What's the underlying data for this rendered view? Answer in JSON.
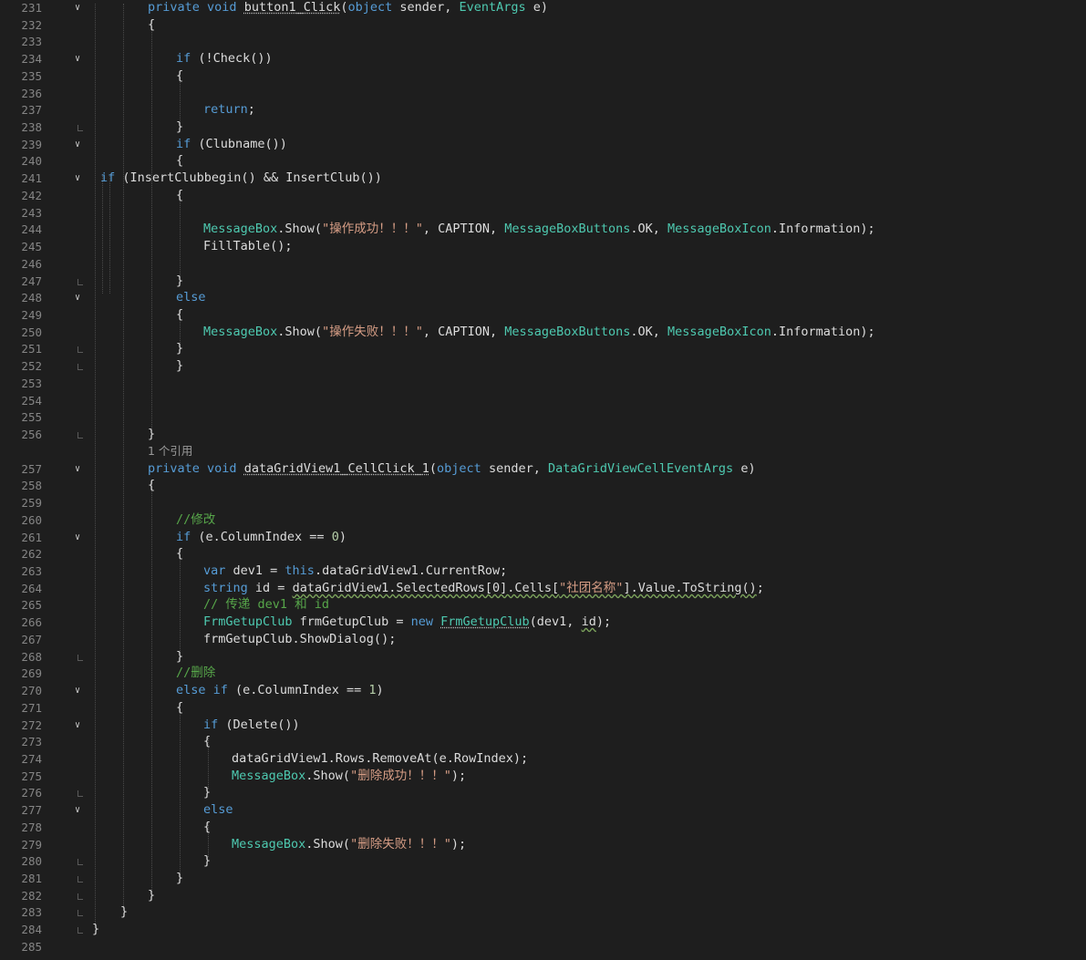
{
  "colors": {
    "background": "#1e1e1e",
    "line_number": "#858585",
    "keyword": "#569cd6",
    "type": "#4ec9b0",
    "string": "#d69d85",
    "comment": "#57a64a",
    "identifier": "#dcdcdc",
    "number": "#b5cea8"
  },
  "icons": {
    "fold_open": "chevron-down-icon",
    "fold_close": "fold-end-bracket"
  },
  "codelens": "1 个引用",
  "lines": [
    {
      "num": "231",
      "fold": "open",
      "indent": 2,
      "tokens": [
        [
          "kw",
          "private"
        ],
        [
          "pl",
          " "
        ],
        [
          "kw",
          "void"
        ],
        [
          "pl",
          " "
        ],
        [
          "pl",
          "button1_Click",
          "dots"
        ],
        [
          "pl",
          "("
        ],
        [
          "kw",
          "object"
        ],
        [
          "pl",
          " sender, "
        ],
        [
          "ty",
          "EventArgs"
        ],
        [
          "pl",
          " e)"
        ]
      ]
    },
    {
      "num": "232",
      "indent": 2,
      "tokens": [
        [
          "pl",
          "{"
        ]
      ]
    },
    {
      "num": "233",
      "tokens": []
    },
    {
      "num": "234",
      "fold": "open",
      "indent": 3,
      "tokens": [
        [
          "kw",
          "if"
        ],
        [
          "pl",
          " (!Check())"
        ]
      ]
    },
    {
      "num": "235",
      "indent": 3,
      "tokens": [
        [
          "pl",
          "{"
        ]
      ]
    },
    {
      "num": "236",
      "tokens": []
    },
    {
      "num": "237",
      "indent": 4,
      "tokens": [
        [
          "kw",
          "return"
        ],
        [
          "pl",
          ";"
        ]
      ]
    },
    {
      "num": "238",
      "fold": "end",
      "indent": 3,
      "tokens": [
        [
          "pl",
          "}"
        ]
      ]
    },
    {
      "num": "239",
      "fold": "open",
      "indent": 3,
      "tokens": [
        [
          "kw",
          "if"
        ],
        [
          "pl",
          " (Clubname())"
        ]
      ]
    },
    {
      "num": "240",
      "indent": 3,
      "tokens": [
        [
          "pl",
          "{"
        ]
      ]
    },
    {
      "num": "241",
      "fold": "open",
      "indent": 0,
      "tokens": [
        [
          "kw",
          "if"
        ],
        [
          "pl",
          " (InsertClubbegin() && InsertClub())"
        ]
      ]
    },
    {
      "num": "242",
      "indent": 3,
      "tokens": [
        [
          "pl",
          "{"
        ]
      ]
    },
    {
      "num": "243",
      "tokens": []
    },
    {
      "num": "244",
      "indent": 4,
      "tokens": [
        [
          "ty",
          "MessageBox"
        ],
        [
          "pl",
          ".Show("
        ],
        [
          "str",
          "\"操作成功！！！\""
        ],
        [
          "pl",
          ", CAPTION, "
        ],
        [
          "ty",
          "MessageBoxButtons"
        ],
        [
          "pl",
          ".OK, "
        ],
        [
          "ty",
          "MessageBoxIcon"
        ],
        [
          "pl",
          ".Information);"
        ]
      ]
    },
    {
      "num": "245",
      "indent": 4,
      "tokens": [
        [
          "pl",
          "FillTable();"
        ]
      ]
    },
    {
      "num": "246",
      "tokens": []
    },
    {
      "num": "247",
      "fold": "end",
      "indent": 3,
      "tokens": [
        [
          "pl",
          "}"
        ]
      ]
    },
    {
      "num": "248",
      "fold": "open",
      "indent": 3,
      "tokens": [
        [
          "kw",
          "else"
        ]
      ]
    },
    {
      "num": "249",
      "indent": 3,
      "tokens": [
        [
          "pl",
          "{"
        ]
      ]
    },
    {
      "num": "250",
      "indent": 4,
      "tokens": [
        [
          "ty",
          "MessageBox"
        ],
        [
          "pl",
          ".Show("
        ],
        [
          "str",
          "\"操作失败！！！\""
        ],
        [
          "pl",
          ", CAPTION, "
        ],
        [
          "ty",
          "MessageBoxButtons"
        ],
        [
          "pl",
          ".OK, "
        ],
        [
          "ty",
          "MessageBoxIcon"
        ],
        [
          "pl",
          ".Information);"
        ]
      ]
    },
    {
      "num": "251",
      "fold": "end",
      "indent": 3,
      "tokens": [
        [
          "pl",
          "}"
        ]
      ]
    },
    {
      "num": "252",
      "fold": "end",
      "indent": 3,
      "tokens": [
        [
          "pl",
          "}"
        ]
      ]
    },
    {
      "num": "253",
      "tokens": []
    },
    {
      "num": "254",
      "tokens": []
    },
    {
      "num": "255",
      "tokens": []
    },
    {
      "num": "256",
      "fold": "end",
      "indent": 2,
      "tokens": [
        [
          "pl",
          "}"
        ]
      ]
    },
    {
      "num": "257",
      "fold": "open",
      "indent": 2,
      "tokens": [
        [
          "kw",
          "private"
        ],
        [
          "pl",
          " "
        ],
        [
          "kw",
          "void"
        ],
        [
          "pl",
          " "
        ],
        [
          "pl",
          "dataGridView1_CellClick_1",
          "dots"
        ],
        [
          "pl",
          "("
        ],
        [
          "kw",
          "object"
        ],
        [
          "pl",
          " sender, "
        ],
        [
          "ty",
          "DataGridViewCellEventArgs"
        ],
        [
          "pl",
          " e)"
        ]
      ]
    },
    {
      "num": "258",
      "indent": 2,
      "tokens": [
        [
          "pl",
          "{"
        ]
      ]
    },
    {
      "num": "259",
      "tokens": []
    },
    {
      "num": "260",
      "indent": 3,
      "tokens": [
        [
          "cm",
          "//修改"
        ]
      ]
    },
    {
      "num": "261",
      "fold": "open",
      "indent": 3,
      "tokens": [
        [
          "kw",
          "if"
        ],
        [
          "pl",
          " (e.ColumnIndex == "
        ],
        [
          "num",
          "0"
        ],
        [
          "pl",
          ")"
        ]
      ]
    },
    {
      "num": "262",
      "indent": 3,
      "tokens": [
        [
          "pl",
          "{"
        ]
      ]
    },
    {
      "num": "263",
      "indent": 4,
      "tokens": [
        [
          "kw",
          "var"
        ],
        [
          "pl",
          " dev1 = "
        ],
        [
          "kw",
          "this"
        ],
        [
          "pl",
          ".dataGridView1.CurrentRow;"
        ]
      ]
    },
    {
      "num": "264",
      "indent": 4,
      "tokens": [
        [
          "kw",
          "string"
        ],
        [
          "pl",
          " id = "
        ],
        [
          "pl",
          "dataGridView1.SelectedRows[0].Cells[",
          "sq"
        ],
        [
          "str",
          "\"社团名称\"",
          "sq"
        ],
        [
          "pl",
          "].Value.ToString()",
          "sq"
        ],
        [
          "pl",
          ";"
        ]
      ]
    },
    {
      "num": "265",
      "indent": 4,
      "tokens": [
        [
          "cm",
          "// 传递 dev1 和 id"
        ]
      ]
    },
    {
      "num": "266",
      "indent": 4,
      "tokens": [
        [
          "ty",
          "FrmGetupClub"
        ],
        [
          "pl",
          " frmGetupClub = "
        ],
        [
          "kw",
          "new"
        ],
        [
          "pl",
          " "
        ],
        [
          "ty",
          "FrmGetupClub",
          "dots"
        ],
        [
          "pl",
          "(dev1, "
        ],
        [
          "pl",
          "id",
          "sq"
        ],
        [
          "pl",
          ");"
        ]
      ]
    },
    {
      "num": "267",
      "indent": 4,
      "tokens": [
        [
          "pl",
          "frmGetupClub.ShowDialog();"
        ]
      ]
    },
    {
      "num": "268",
      "fold": "end",
      "indent": 3,
      "tokens": [
        [
          "pl",
          "}"
        ]
      ]
    },
    {
      "num": "269",
      "indent": 3,
      "tokens": [
        [
          "cm",
          "//删除"
        ]
      ]
    },
    {
      "num": "270",
      "fold": "open",
      "indent": 3,
      "tokens": [
        [
          "kw",
          "else"
        ],
        [
          "pl",
          " "
        ],
        [
          "kw",
          "if"
        ],
        [
          "pl",
          " (e.ColumnIndex == "
        ],
        [
          "num",
          "1"
        ],
        [
          "pl",
          ")"
        ]
      ]
    },
    {
      "num": "271",
      "indent": 3,
      "tokens": [
        [
          "pl",
          "{"
        ]
      ]
    },
    {
      "num": "272",
      "fold": "open",
      "indent": 4,
      "tokens": [
        [
          "kw",
          "if"
        ],
        [
          "pl",
          " (Delete())"
        ]
      ]
    },
    {
      "num": "273",
      "indent": 4,
      "tokens": [
        [
          "pl",
          "{"
        ]
      ]
    },
    {
      "num": "274",
      "indent": 5,
      "tokens": [
        [
          "pl",
          "dataGridView1.Rows.RemoveAt(e.RowIndex);"
        ]
      ]
    },
    {
      "num": "275",
      "indent": 5,
      "tokens": [
        [
          "ty",
          "MessageBox"
        ],
        [
          "pl",
          ".Show("
        ],
        [
          "str",
          "\"删除成功！！！\""
        ],
        [
          "pl",
          ");"
        ]
      ]
    },
    {
      "num": "276",
      "fold": "end",
      "indent": 4,
      "tokens": [
        [
          "pl",
          "}"
        ]
      ]
    },
    {
      "num": "277",
      "fold": "open",
      "indent": 4,
      "tokens": [
        [
          "kw",
          "else"
        ]
      ]
    },
    {
      "num": "278",
      "indent": 4,
      "tokens": [
        [
          "pl",
          "{"
        ]
      ]
    },
    {
      "num": "279",
      "indent": 5,
      "tokens": [
        [
          "ty",
          "MessageBox"
        ],
        [
          "pl",
          ".Show("
        ],
        [
          "str",
          "\"删除失败！！！\""
        ],
        [
          "pl",
          ");"
        ]
      ]
    },
    {
      "num": "280",
      "fold": "end",
      "indent": 4,
      "tokens": [
        [
          "pl",
          "}"
        ]
      ]
    },
    {
      "num": "281",
      "fold": "end",
      "indent": 3,
      "tokens": [
        [
          "pl",
          "}"
        ]
      ]
    },
    {
      "num": "282",
      "fold": "end",
      "indent": 2,
      "tokens": [
        [
          "pl",
          "}"
        ]
      ]
    },
    {
      "num": "283",
      "fold": "end",
      "indent": 1,
      "tokens": [
        [
          "pl",
          "}"
        ]
      ]
    },
    {
      "num": "284",
      "fold": "end",
      "indent": 0,
      "brace_root": true,
      "tokens": [
        [
          "pl",
          "}"
        ]
      ]
    },
    {
      "num": "285",
      "tokens": []
    }
  ]
}
